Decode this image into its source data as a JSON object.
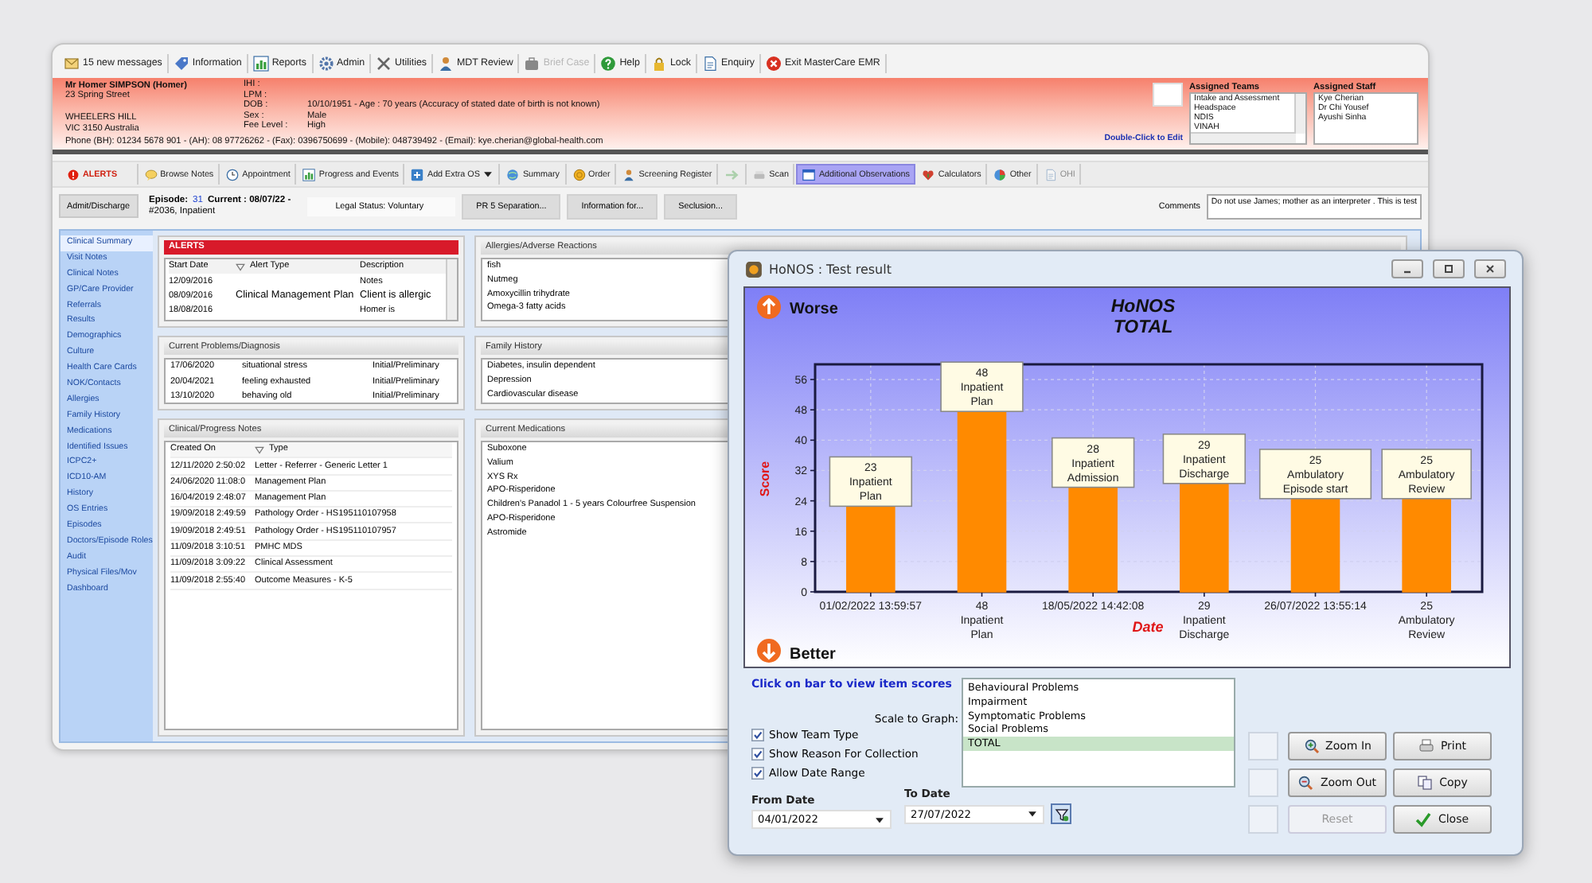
{
  "main_window": {
    "toolbar": [
      {
        "label": "15 new messages",
        "disabled": false
      },
      {
        "label": "Information",
        "disabled": false
      },
      {
        "label": "Reports",
        "disabled": false
      },
      {
        "label": "Admin",
        "disabled": false
      },
      {
        "label": "Utilities",
        "disabled": false
      },
      {
        "label": "MDT Review",
        "disabled": false
      },
      {
        "label": "Brief Case",
        "disabled": true
      },
      {
        "label": "Help",
        "disabled": false
      },
      {
        "label": "Lock",
        "disabled": false
      },
      {
        "label": "Enquiry",
        "disabled": false
      },
      {
        "label": "Exit MasterCare EMR",
        "disabled": false
      }
    ],
    "patient": {
      "name": "Mr Homer SIMPSON (Homer)",
      "street": "23 Spring Street",
      "suburb": "WHEELERS HILL",
      "state_line": "VIC 3150 Australia",
      "fields": [
        {
          "label": "IHI :"
        },
        {
          "label": "LPM :"
        },
        {
          "label": "DOB :",
          "value": "10/10/1951 - Age : 70 years (Accuracy of stated date of birth is not known)"
        },
        {
          "label": "Sex :",
          "value": "Male"
        },
        {
          "label": "Fee Level :",
          "value": "High"
        }
      ],
      "phone": "Phone (BH): 01234 5678 901 - (AH): 08 97726262 - (Fax): 0396750699 - (Mobile): 048739492 - (Email): kye.cherian@global-health.com",
      "edit_hint": "Double-Click to Edit",
      "assigned_teams": {
        "title": "Assigned Teams",
        "items": [
          "Intake and Assessment",
          "Headspace",
          "NDIS",
          "VINAH"
        ]
      },
      "assigned_staff": {
        "title": "Assigned Staff",
        "items": [
          "Kye Cherian",
          "Dr Chi Yousef",
          "Ayushi Sinha"
        ]
      }
    },
    "actions": [
      {
        "kind": "alert",
        "label": "ALERTS",
        "selected": false,
        "disabled": false
      },
      {
        "kind": "button",
        "label": "Browse Notes",
        "selected": false,
        "disabled": false
      },
      {
        "kind": "button",
        "label": "Appointment",
        "selected": false,
        "disabled": false
      },
      {
        "kind": "button",
        "label": "Progress and Events",
        "selected": false,
        "disabled": false
      },
      {
        "kind": "dropdown",
        "label": "Add Extra OS",
        "selected": false,
        "disabled": false
      },
      {
        "kind": "button",
        "label": "Summary",
        "selected": false,
        "disabled": false
      },
      {
        "kind": "button",
        "label": "Order",
        "selected": false,
        "disabled": false
      },
      {
        "kind": "button",
        "label": "Screening Register",
        "selected": false,
        "disabled": false
      },
      {
        "kind": "icon",
        "selected": false,
        "disabled": true
      },
      {
        "kind": "button",
        "label": "Scan",
        "selected": false,
        "disabled": false
      },
      {
        "kind": "button",
        "label": "Additional Observations",
        "selected": true,
        "disabled": false
      },
      {
        "kind": "button",
        "label": "Calculators",
        "selected": false,
        "disabled": false
      },
      {
        "kind": "button",
        "label": "Other",
        "selected": false,
        "disabled": false
      },
      {
        "kind": "button",
        "label": "OHI",
        "selected": false,
        "disabled": true
      }
    ],
    "episode": {
      "button": "Admit/Discharge",
      "episode_label": "Episode:",
      "episode_number": "31",
      "current": "Current : 08/07/22 -",
      "detail": "#2036, Inpatient",
      "legal_status": "Legal Status: Voluntary",
      "tabs": [
        {
          "label": "PR 5 Separation...",
          "selected": false
        },
        {
          "label": "Information for...",
          "selected": false
        },
        {
          "label": "Seclusion...",
          "selected": false
        }
      ],
      "comments_label": "Comments",
      "comments": "Do not use James; mother as an interpreter . This is test"
    },
    "sidebar": {
      "items": [
        {
          "label": "Clinical Summary",
          "selected": true
        },
        {
          "label": "Visit Notes",
          "selected": false
        },
        {
          "label": "Clinical Notes",
          "selected": false
        },
        {
          "label": "GP/Care Provider",
          "selected": false
        },
        {
          "label": "Referrals",
          "selected": false
        },
        {
          "label": "Results",
          "selected": false
        },
        {
          "label": "Demographics",
          "selected": false
        },
        {
          "label": "Culture",
          "selected": false
        },
        {
          "label": "Health Care Cards",
          "selected": false
        },
        {
          "label": "NOK/Contacts",
          "selected": false
        },
        {
          "label": "Allergies",
          "selected": false
        },
        {
          "label": "Family History",
          "selected": false
        },
        {
          "label": "Medications",
          "selected": false
        },
        {
          "label": "Identified Issues",
          "selected": false
        },
        {
          "label": "ICPC2+",
          "selected": false
        },
        {
          "label": "ICD10-AM",
          "selected": false
        },
        {
          "label": "History",
          "selected": false
        },
        {
          "label": "OS Entries",
          "selected": false
        },
        {
          "label": "Episodes",
          "selected": false
        },
        {
          "label": "Doctors/Episode Roles",
          "selected": false
        },
        {
          "label": "Audit",
          "selected": false
        },
        {
          "label": "Physical Files/Mov",
          "selected": false
        },
        {
          "label": "Dashboard",
          "selected": false
        }
      ]
    },
    "alerts": {
      "title": "ALERTS",
      "columns": [
        "Start Date",
        "Alert Type",
        "Description"
      ],
      "rows": [
        {
          "start": "12/09/2016",
          "description": "Notes"
        },
        {
          "start": "08/09/2016",
          "type": "Clinical Management Plan",
          "description": "Client is allergic"
        },
        {
          "start": "18/08/2016",
          "description": "Homer is"
        }
      ]
    },
    "allergies": {
      "title": "Allergies/Adverse Reactions",
      "items": [
        "fish",
        "Nutmeg",
        "Amoxycillin trihydrate",
        "Omega-3 fatty acids"
      ]
    },
    "problems": {
      "title": "Current Problems/Diagnosis",
      "rows": [
        [
          "17/06/2020",
          "situational stress",
          "Initial/Preliminary"
        ],
        [
          "20/04/2021",
          "feeling exhausted",
          "Initial/Preliminary"
        ],
        [
          "13/10/2020",
          "behaving old",
          "Initial/Preliminary"
        ]
      ]
    },
    "family_history": {
      "title": "Family History",
      "items": [
        "Diabetes, insulin dependent",
        "Depression",
        "Cardiovascular disease"
      ]
    },
    "notes": {
      "title": "Clinical/Progress Notes",
      "columns": [
        "Created On",
        "Type"
      ],
      "rows": [
        [
          "12/11/2020 2:50:02",
          "Letter - Referrer - Generic Letter 1"
        ],
        [
          "24/06/2020 11:08:0",
          "Management Plan"
        ],
        [
          "16/04/2019 2:48:07",
          "Management Plan"
        ],
        [
          "19/09/2018 2:49:59",
          "Pathology Order - HS195110107958"
        ],
        [
          "19/09/2018 2:49:51",
          "Pathology Order - HS195110107957"
        ],
        [
          "11/09/2018 3:10:51",
          "PMHC MDS"
        ],
        [
          "11/09/2018 3:09:22",
          "Clinical Assessment"
        ],
        [
          "11/09/2018 2:55:40",
          "Outcome Measures - K-5"
        ]
      ]
    },
    "medications": {
      "title": "Current Medications",
      "items": [
        "Suboxone",
        "Valium",
        "XYS Rx",
        "APO-Risperidone",
        "Children's Panadol 1 - 5 years Colourfree Suspension",
        "APO-Risperidone",
        "Astromide"
      ]
    }
  },
  "dialog": {
    "title": "HoNOS : Test result",
    "worse_label": "Worse",
    "better_label": "Better",
    "chart_data": {
      "type": "bar",
      "title": "HoNOS\nTOTAL",
      "xlabel": "Date",
      "ylabel": "Score",
      "categories": [
        "01/02/2022 13:59:57",
        "48\nInpatient\nPlan",
        "18/05/2022 14:42:08",
        "29\nInpatient\nDischarge",
        "26/07/2022 13:55:14",
        "25\nAmbulatory\nReview"
      ],
      "series": [
        {
          "color": "#ff8a00",
          "values": [
            23,
            48,
            28,
            29,
            25,
            25
          ]
        }
      ],
      "ylim": [
        0,
        60
      ],
      "yticks": [
        0,
        8,
        16,
        24,
        32,
        40,
        48,
        56
      ],
      "grid": true,
      "annotations": [
        {
          "text": "23\nInpatient\nPlan"
        },
        {
          "text": "48\nInpatient\nPlan"
        },
        {
          "text": "28\nInpatient\nAdmission"
        },
        {
          "text": "29\nInpatient\nDischarge"
        },
        {
          "text": "25\nAmbulatory\nEpisode start"
        },
        {
          "text": "25\nAmbulatory\nReview"
        }
      ]
    },
    "hint": "Click on bar to view item scores",
    "scale_label": "Scale to Graph:",
    "scales": [
      {
        "label": "Behavioural Problems",
        "selected": false
      },
      {
        "label": "Impairment",
        "selected": false
      },
      {
        "label": "Symptomatic Problems",
        "selected": false
      },
      {
        "label": "Social Problems",
        "selected": false
      },
      {
        "label": "TOTAL",
        "selected": true
      }
    ],
    "options": [
      {
        "label": "Show Team Type",
        "checked": true
      },
      {
        "label": "Show Reason For Collection",
        "checked": true
      },
      {
        "label": "Allow Date Range",
        "checked": true
      }
    ],
    "from_label": "From Date",
    "from_date": "04/01/2022",
    "to_label": "To Date",
    "to_date": "27/07/2022",
    "buttons": [
      {
        "label": "Zoom In",
        "disabled": false
      },
      {
        "label": "Print",
        "disabled": false
      },
      {
        "label": "Zoom Out",
        "disabled": false
      },
      {
        "label": "Copy",
        "disabled": false
      },
      {
        "label": "Reset",
        "disabled": true
      },
      {
        "label": "Close",
        "disabled": false
      }
    ]
  }
}
